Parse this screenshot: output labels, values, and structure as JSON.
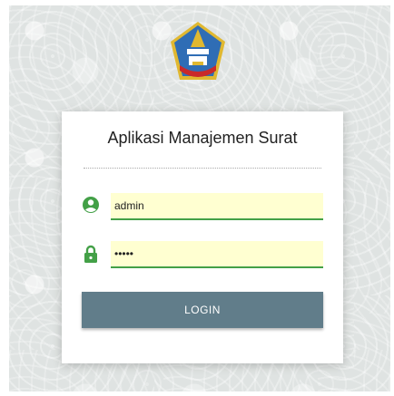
{
  "login_card": {
    "title": "Aplikasi Manajemen Surat",
    "username": {
      "value": "admin",
      "icon": "account-circle-icon"
    },
    "password": {
      "value": "•••••",
      "icon": "lock-icon"
    },
    "submit_label": "LOGIN"
  },
  "colors": {
    "background": "#dfe3e2",
    "input_fill": "#ffffd1",
    "accent_green": "#43a047",
    "button": "#617d8a",
    "logo_blue": "#2f6db5",
    "logo_gold": "#e0b830"
  }
}
